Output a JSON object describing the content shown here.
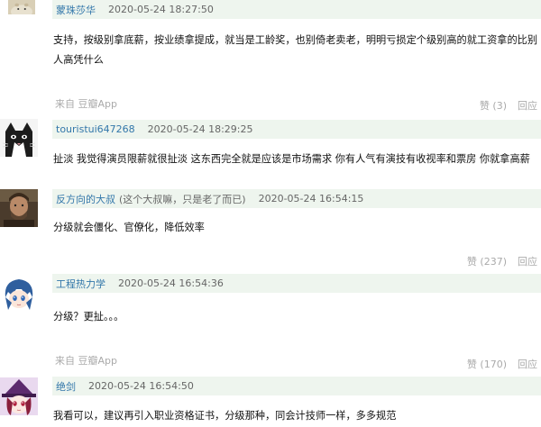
{
  "comments": [
    {
      "user": "蒙珠莎华",
      "signature": "",
      "time": "2020-05-24 18:27:50",
      "text": "支持，按级别拿底薪，按业绩拿提成，就当是工龄奖，也别倚老卖老，明明亏损定个级别高的就工资拿的比别人高凭什么",
      "source": "来自 豆瓣App",
      "like": "赞 (3)",
      "reply": "回应"
    },
    {
      "user": "touristui647268",
      "signature": "",
      "time": "2020-05-24 18:29:25",
      "text": "扯淡 我觉得演员限薪就很扯淡 这东西完全就是应该是市场需求 你有人气有演技有收视率和票房 你就拿高薪",
      "source": "",
      "like": "",
      "reply": ""
    },
    {
      "user": "反方向的大叔",
      "signature": "(这个大叔嘛，只是老了而已)",
      "time": "2020-05-24 16:54:15",
      "text": "分级就会僵化、官僚化，降低效率",
      "source": "",
      "like": "赞 (237)",
      "reply": "回应"
    },
    {
      "user": "工程热力学",
      "signature": "",
      "time": "2020-05-24 16:54:36",
      "text": "分级？更扯。。。",
      "source": "来自 豆瓣App",
      "like": "赞 (170)",
      "reply": "回应"
    },
    {
      "user": "绝剑",
      "signature": "",
      "time": "2020-05-24 16:54:50",
      "text": "我看可以，建议再引入职业资格证书，分级那种，同会计技师一样，多多规范",
      "source": "",
      "like": "",
      "reply": ""
    }
  ],
  "colors": {
    "username": "#3377aa",
    "header_background": "#eef5ee",
    "meta_text": "#aaaaaa"
  },
  "icons": [
    "rabbit-avatar-icon",
    "cat-avatar-icon",
    "man-photo-avatar-icon",
    "anime-avatar-icon",
    "witch-avatar-icon"
  ]
}
